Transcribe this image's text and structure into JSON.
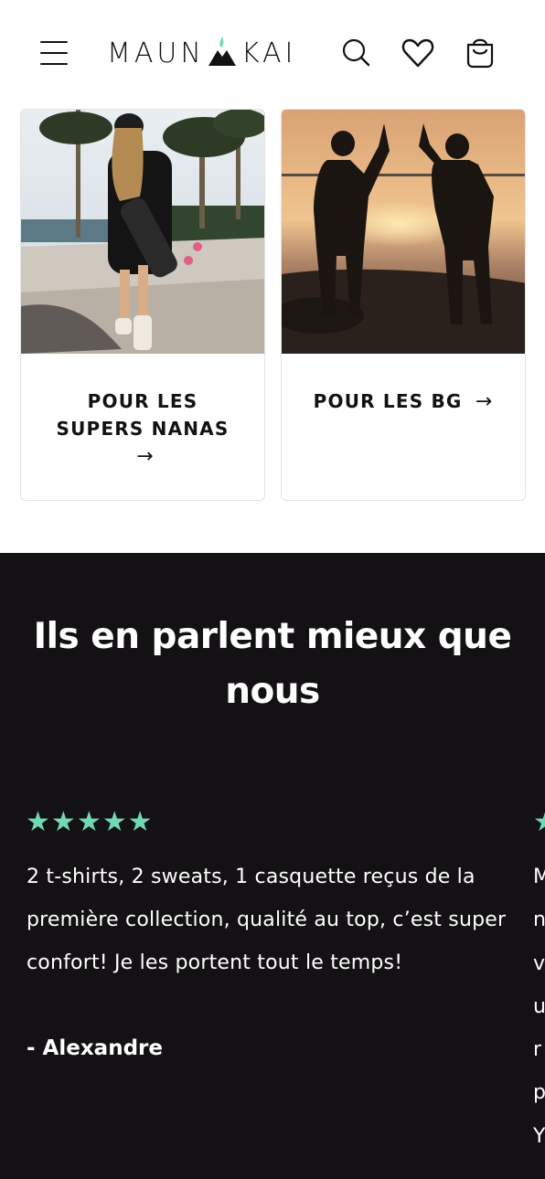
{
  "header": {
    "menu_icon": "hamburger-menu-icon",
    "logo_text_left": "MAUN",
    "logo_text_right": "KAI",
    "search_icon": "search-icon",
    "wishlist_icon": "heart-icon",
    "cart_icon": "shopping-bag-icon"
  },
  "collections": [
    {
      "title": "POUR LES SUPERS NANAS",
      "arrow": "→"
    },
    {
      "title": "POUR LES BG",
      "arrow": "→"
    }
  ],
  "testimonials": {
    "title": "Ils en parlent mieux que nous",
    "rating_stars": "★★★★★",
    "items": [
      {
        "text": "2 t-shirts, 2 sweats, 1 casquette reçus de la première collection, qualité au top, c’est super confort! Je les portent tout le temps!",
        "author": "- Alexandre"
      }
    ],
    "next_peek_letters": "M\nn\nv\nu\nr\np\nY"
  },
  "colors": {
    "star_color": "#6fd8b4",
    "dark_section_bg": "#131113",
    "logo_drop": "#6fd8b4"
  }
}
